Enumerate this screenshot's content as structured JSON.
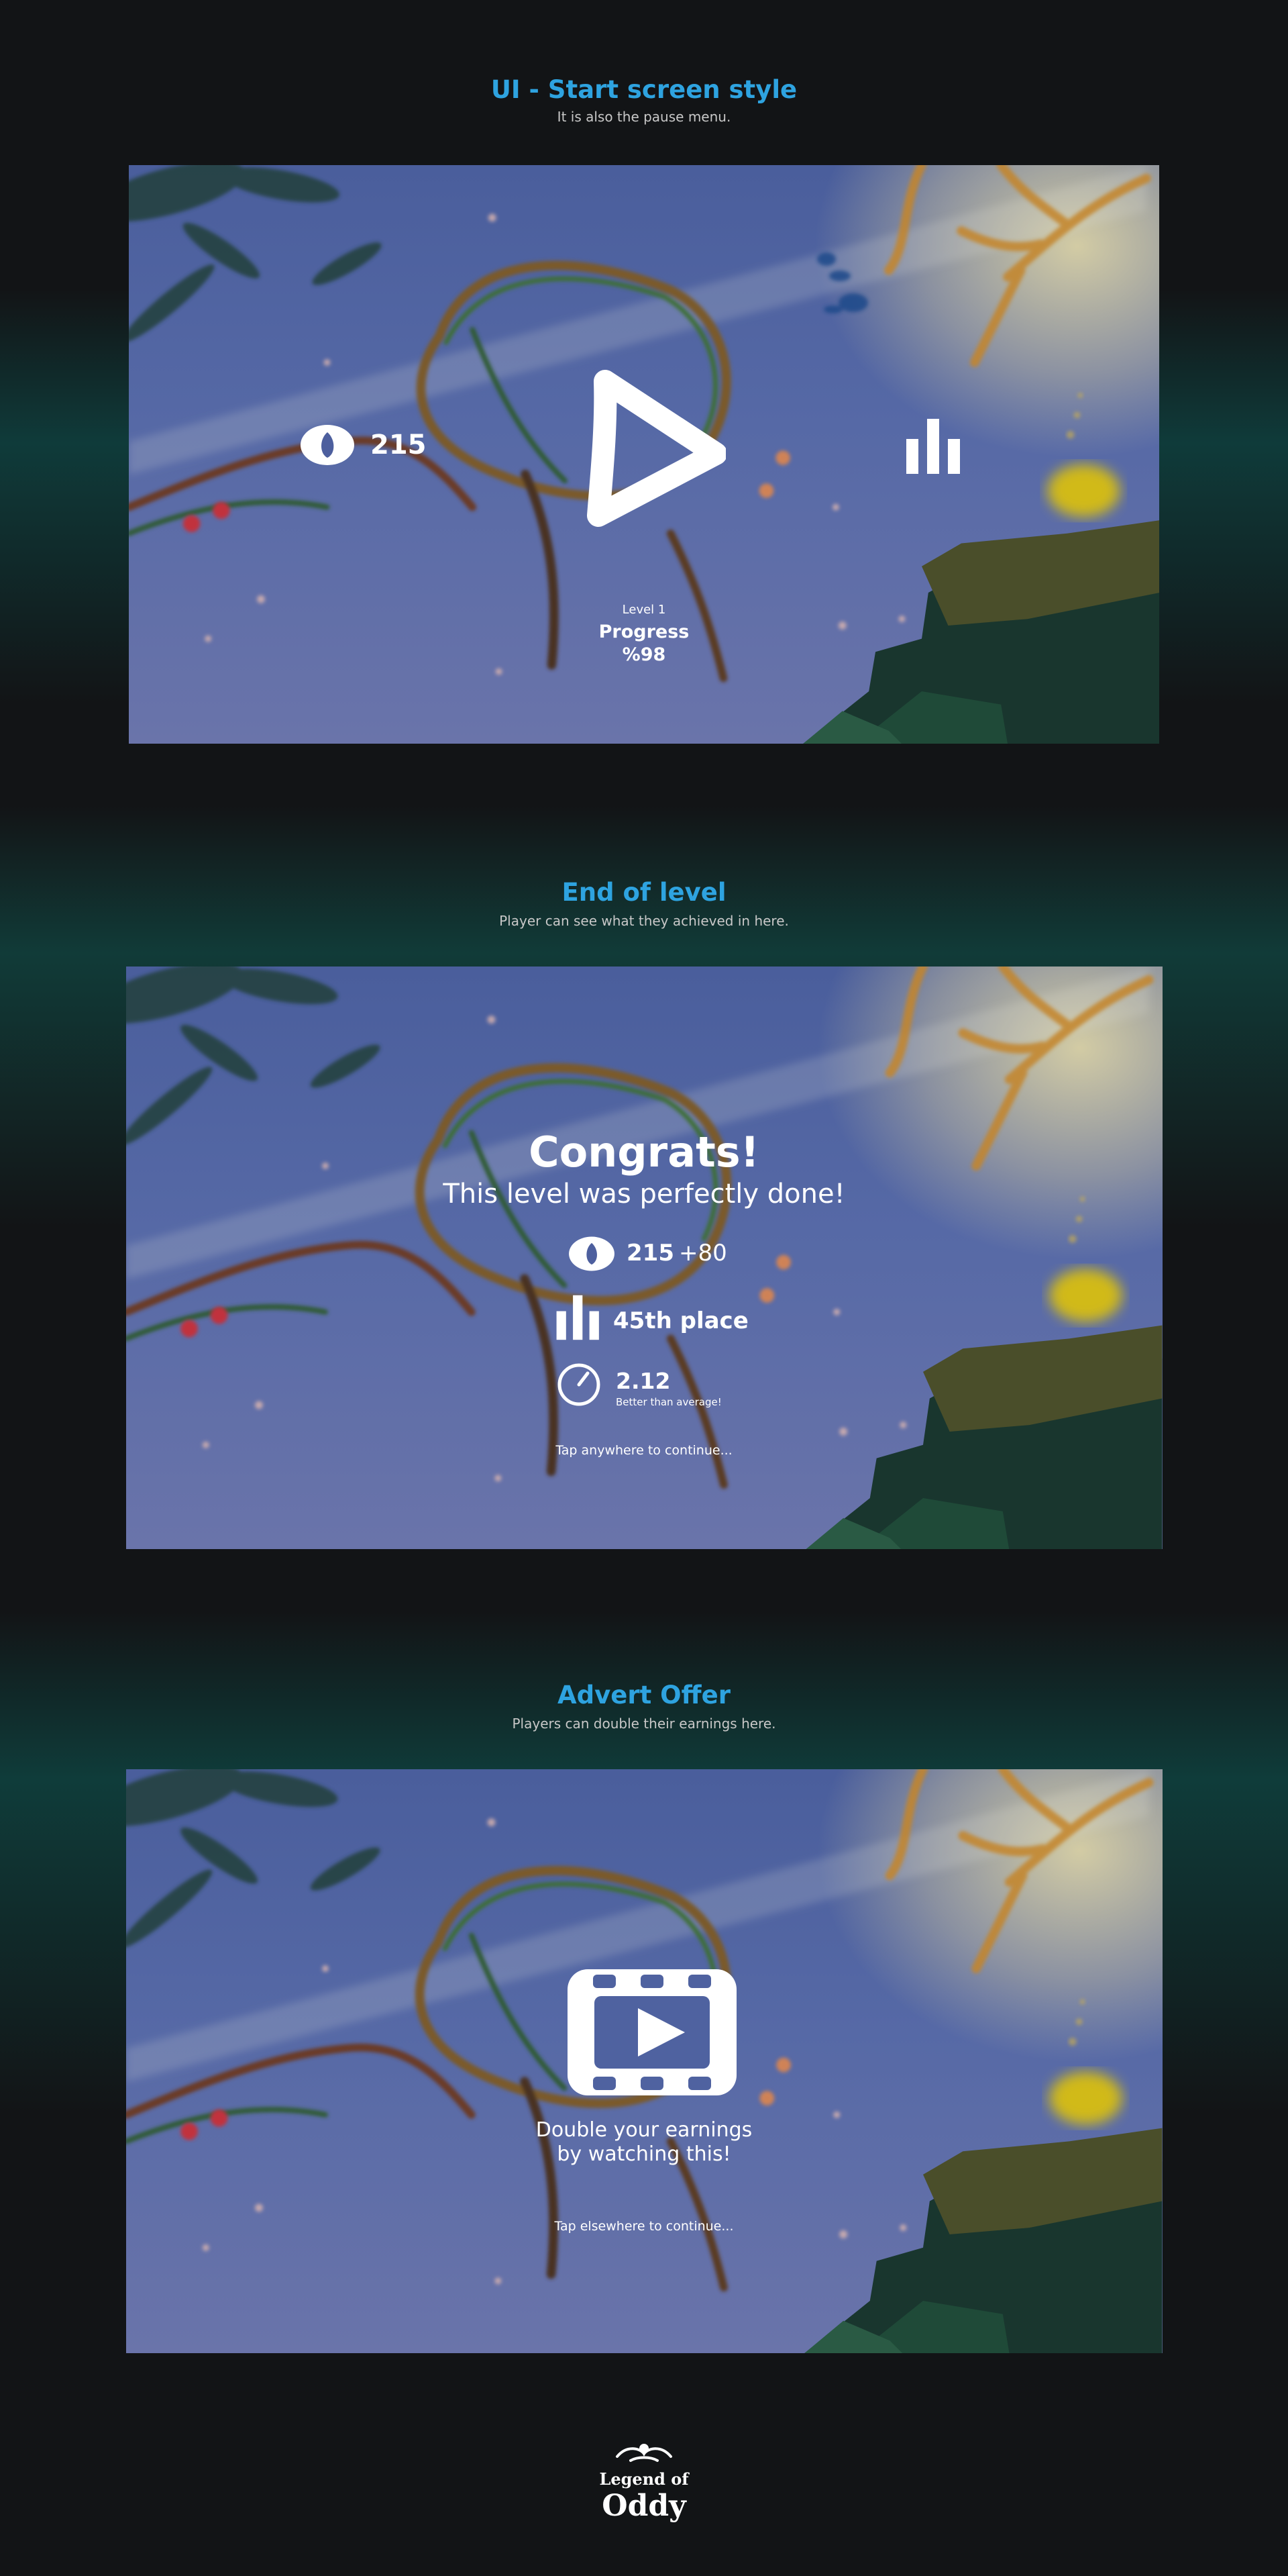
{
  "sections": [
    {
      "title": "UI - Start screen style",
      "subtitle": "It is also the pause menu."
    },
    {
      "title": "End of level",
      "subtitle": "Player can see what they achieved in here."
    },
    {
      "title": "Advert Offer",
      "subtitle": "Players can double their earnings here."
    }
  ],
  "start_screen": {
    "seed_count": "215",
    "level_label": "Level 1",
    "progress_label": "Progress",
    "progress_value": "%98",
    "icons": [
      "seed-icon",
      "play-icon",
      "leaderboard-icon"
    ]
  },
  "end_level": {
    "heading": "Congrats!",
    "message": "This level was perfectly done!",
    "seed_count": "215",
    "seed_bonus": "+80",
    "rank": "45th place",
    "time_value": "2.12",
    "time_note": "Better than average!",
    "continue_hint": "Tap anywhere to continue...",
    "icons": [
      "seed-icon",
      "leaderboard-icon",
      "timer-icon"
    ]
  },
  "advert": {
    "line1": "Double your earnings",
    "line2": "by watching this!",
    "continue_hint": "Tap elsewhere to continue...",
    "icons": [
      "video-play-icon"
    ]
  },
  "logo": {
    "line1": "Legend of",
    "line2": "Oddy"
  },
  "colors": {
    "accent": "#2ea3e0",
    "background": "#121416",
    "teal_glow": "#0f3b3a",
    "ui_text": "#ffffff"
  }
}
